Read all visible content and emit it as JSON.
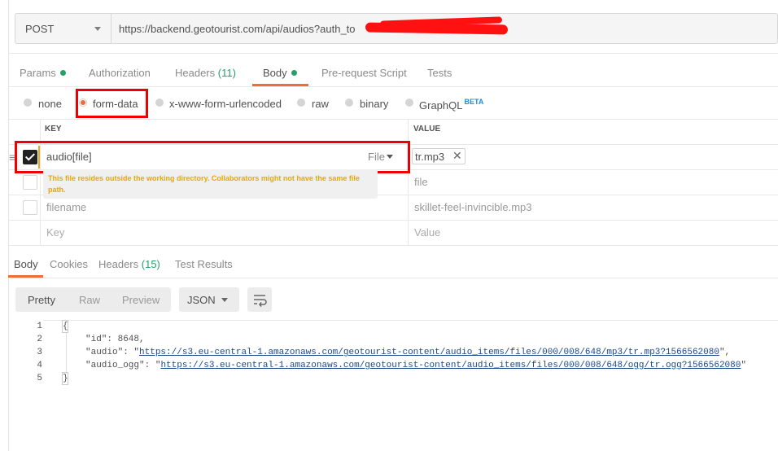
{
  "request": {
    "method": "POST",
    "url": "https://backend.geotourist.com/api/audios?auth_to"
  },
  "request_tabs": [
    {
      "label": "Params",
      "dot": true
    },
    {
      "label": "Authorization"
    },
    {
      "label": "Headers",
      "count": "(11)"
    },
    {
      "label": "Body",
      "dot": true,
      "active": true
    },
    {
      "label": "Pre-request Script"
    },
    {
      "label": "Tests"
    }
  ],
  "body_types": [
    "none",
    "form-data",
    "x-www-form-urlencoded",
    "raw",
    "binary",
    "GraphQL"
  ],
  "body_type_selected": "form-data",
  "graphql_badge": "BETA",
  "table": {
    "headers": {
      "key": "KEY",
      "value": "VALUE"
    },
    "rows": [
      {
        "checked": true,
        "key": "audio[file]",
        "type": "File",
        "value": "tr.mp3"
      },
      {
        "checked": false,
        "key": "",
        "value": "file"
      },
      {
        "checked": false,
        "key": "filename",
        "value": "skillet-feel-invincible.mp3"
      }
    ],
    "new_row": {
      "key_placeholder": "Key",
      "value_placeholder": "Value"
    },
    "tooltip": "This file resides outside the working directory. Collaborators might not have the same file path."
  },
  "response_tabs": [
    {
      "label": "Body",
      "active": true
    },
    {
      "label": "Cookies"
    },
    {
      "label": "Headers",
      "count": "(15)"
    },
    {
      "label": "Test Results"
    }
  ],
  "view_modes": [
    "Pretty",
    "Raw",
    "Preview"
  ],
  "format": "JSON",
  "wrap_icon": "wrap-lines-icon",
  "response_lines": {
    "numbers": [
      "1",
      "2",
      "3",
      "4",
      "5"
    ],
    "open": "{",
    "id_key": "\"id\"",
    "id_value": "8648",
    "audio_key": "\"audio\"",
    "audio_value": "https://s3.eu-central-1.amazonaws.com/geotourist-content/audio_items/files/000/008/648/mp3/tr.mp3?1566562080",
    "audio_ogg_key": "\"audio_ogg\"",
    "audio_ogg_value": "https://s3.eu-central-1.amazonaws.com/geotourist-content/audio_items/files/000/008/648/ogg/tr.ogg?1566562080",
    "close": "}"
  },
  "colors": {
    "accent": "#f26b3a",
    "green": "#24a06a",
    "highlight": "#e00000",
    "warning": "#f0a500"
  }
}
